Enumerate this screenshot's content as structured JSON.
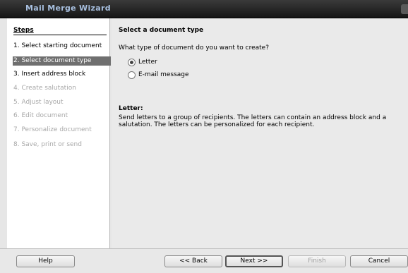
{
  "window": {
    "title": "Mail Merge Wizard"
  },
  "sidebar": {
    "title": "Steps",
    "steps": [
      {
        "label": "1. Select starting document",
        "state": "done"
      },
      {
        "label": "2. Select document type",
        "state": "active"
      },
      {
        "label": "3. Insert address block",
        "state": "done"
      },
      {
        "label": "4. Create salutation",
        "state": "disabled"
      },
      {
        "label": "5. Adjust layout",
        "state": "disabled"
      },
      {
        "label": "6. Edit document",
        "state": "disabled"
      },
      {
        "label": "7. Personalize document",
        "state": "disabled"
      },
      {
        "label": "8. Save, print or send",
        "state": "disabled"
      }
    ]
  },
  "main": {
    "heading": "Select a document type",
    "question": "What type of document do you want to create?",
    "options": [
      {
        "label": "Letter",
        "checked": true
      },
      {
        "label": "E-mail message",
        "checked": false
      }
    ],
    "description_title": "Letter:",
    "description": "Send letters to a group of recipients. The letters can contain an address block and a salutation. The letters can be personalized for each recipient."
  },
  "buttons": {
    "help": "Help",
    "back": "<< Back",
    "next": "Next >>",
    "finish": "Finish",
    "cancel": "Cancel"
  }
}
